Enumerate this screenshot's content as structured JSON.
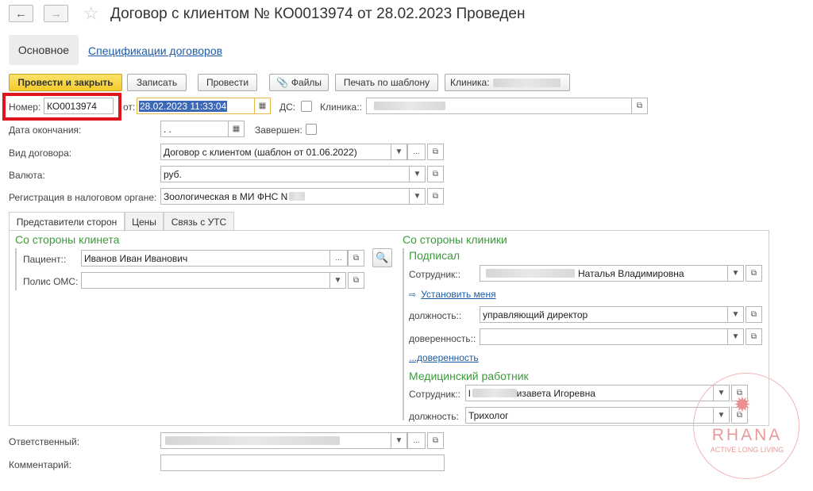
{
  "header": {
    "back_label": "←",
    "forward_label": "→",
    "star_label": "☆",
    "title": "Договор с клиентом № КО0013974 от 28.02.2023 Проведен"
  },
  "nav": {
    "main_tab": "Основное",
    "spec_link": "Спецификации договоров"
  },
  "toolbar": {
    "post_close": "Провести и закрыть",
    "save": "Записать",
    "post": "Провести",
    "files": "Файлы",
    "print": "Печать по шаблону",
    "clinic": "Клиника:"
  },
  "form": {
    "number_label": "Номер:",
    "number_value": "КО0013974",
    "from_label": "от:",
    "date_value": "28.02.2023 11:33:04",
    "ds_label": "ДС:",
    "clinic_label": "Клиника::",
    "end_date_label": "Дата окончания:",
    "end_date_value": " .  .",
    "completed_label": "Завершен:",
    "contract_type_label": "Вид договора:",
    "contract_type_value": "Договор с клиентом (шаблон от 01.06.2022)",
    "currency_label": "Валюта:",
    "currency_value": "руб.",
    "tax_label": "Регистрация в налоговом органе:",
    "tax_value": "Зоологическая в МИ ФНС N",
    "responsible_label": "Ответственный:",
    "comment_label": "Комментарий:"
  },
  "tabs": [
    {
      "label": "Представители сторон"
    },
    {
      "label": "Цены"
    },
    {
      "label": "Связь с УТС"
    }
  ],
  "client_side": {
    "title": "Со стороны клинета",
    "patient_label": "Пациент::",
    "patient_value": "Иванов Иван Иванович",
    "oms_label": "Полис ОМС:"
  },
  "clinic_side": {
    "title": "Со стороны клиники",
    "signed_title": "Подписал",
    "employee_label": "Сотрудник::",
    "employee_value": "Наталья Владимировна",
    "set_me": "Установить меня",
    "position_label": "должность::",
    "position_value": "управляющий директор",
    "power_label": "доверенность::",
    "power_link": "...доверенность",
    "medic_title": "Медицинский работник",
    "medic_employee_label": "Сотрудник::",
    "medic_employee_prefix": "l",
    "medic_employee_value": "изавета Игоревна",
    "medic_position_label": "должность:",
    "medic_position_value": "Трихолог"
  },
  "watermark": {
    "brand": "RHANA",
    "tagline": "ACTIVE LONG LIVING"
  },
  "colors": {
    "accent_yellow": "#f3ca2c",
    "highlight_red": "#e0141b",
    "group_green": "#3c9a3c",
    "link_blue": "#1c5ca8",
    "watermark": "#e89a9a"
  }
}
